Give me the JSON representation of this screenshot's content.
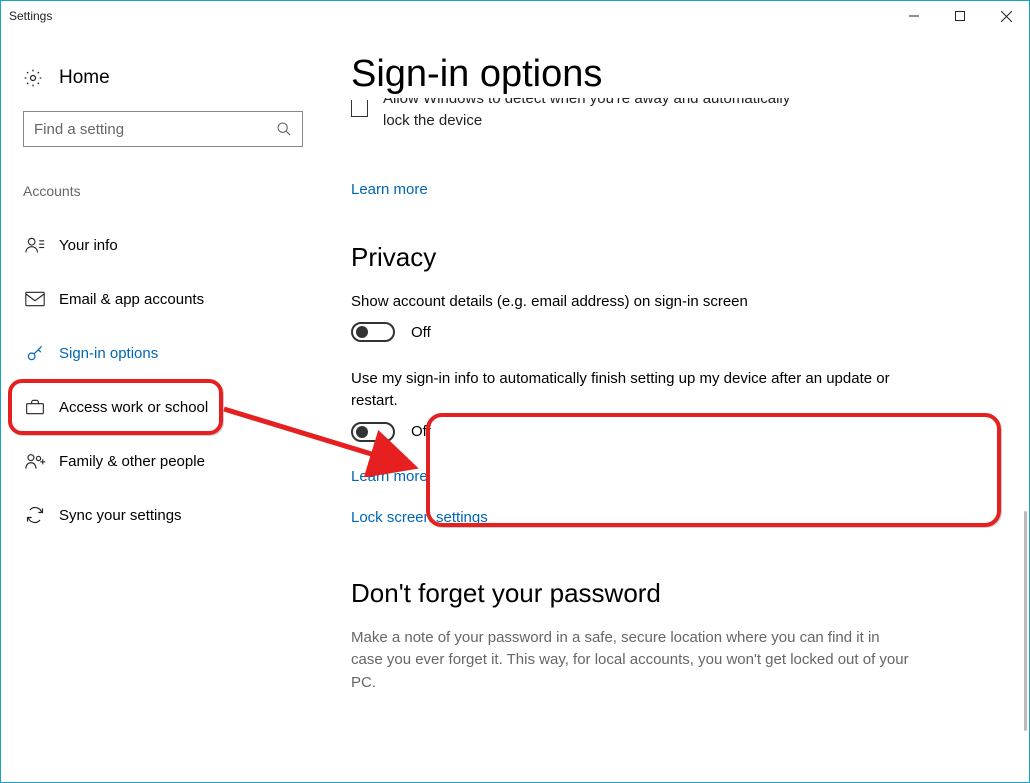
{
  "window": {
    "title": "Settings"
  },
  "sidebar": {
    "home": "Home",
    "search_placeholder": "Find a setting",
    "section": "Accounts",
    "items": [
      {
        "label": "Your info"
      },
      {
        "label": "Email & app accounts"
      },
      {
        "label": "Sign-in options"
      },
      {
        "label": "Access work or school"
      },
      {
        "label": "Family & other people"
      },
      {
        "label": "Sync your settings"
      }
    ]
  },
  "main": {
    "title": "Sign-in options",
    "truncated_line1": "Allow Windows to detect when you're away and automatically",
    "truncated_line2": "lock the device",
    "learn_more": "Learn more",
    "privacy_heading": "Privacy",
    "setting1_desc": "Show account details (e.g. email address) on sign-in screen",
    "setting2_desc": "Use my sign-in info to automatically finish setting up my device after an update or restart.",
    "toggle_off": "Off",
    "lock_screen_link": "Lock screen settings",
    "pwd_heading": "Don't forget your password",
    "pwd_note": "Make a note of your password in a safe, secure location where you can find it in case you ever forget it. This way, for local accounts, you won't get locked out of your PC."
  }
}
